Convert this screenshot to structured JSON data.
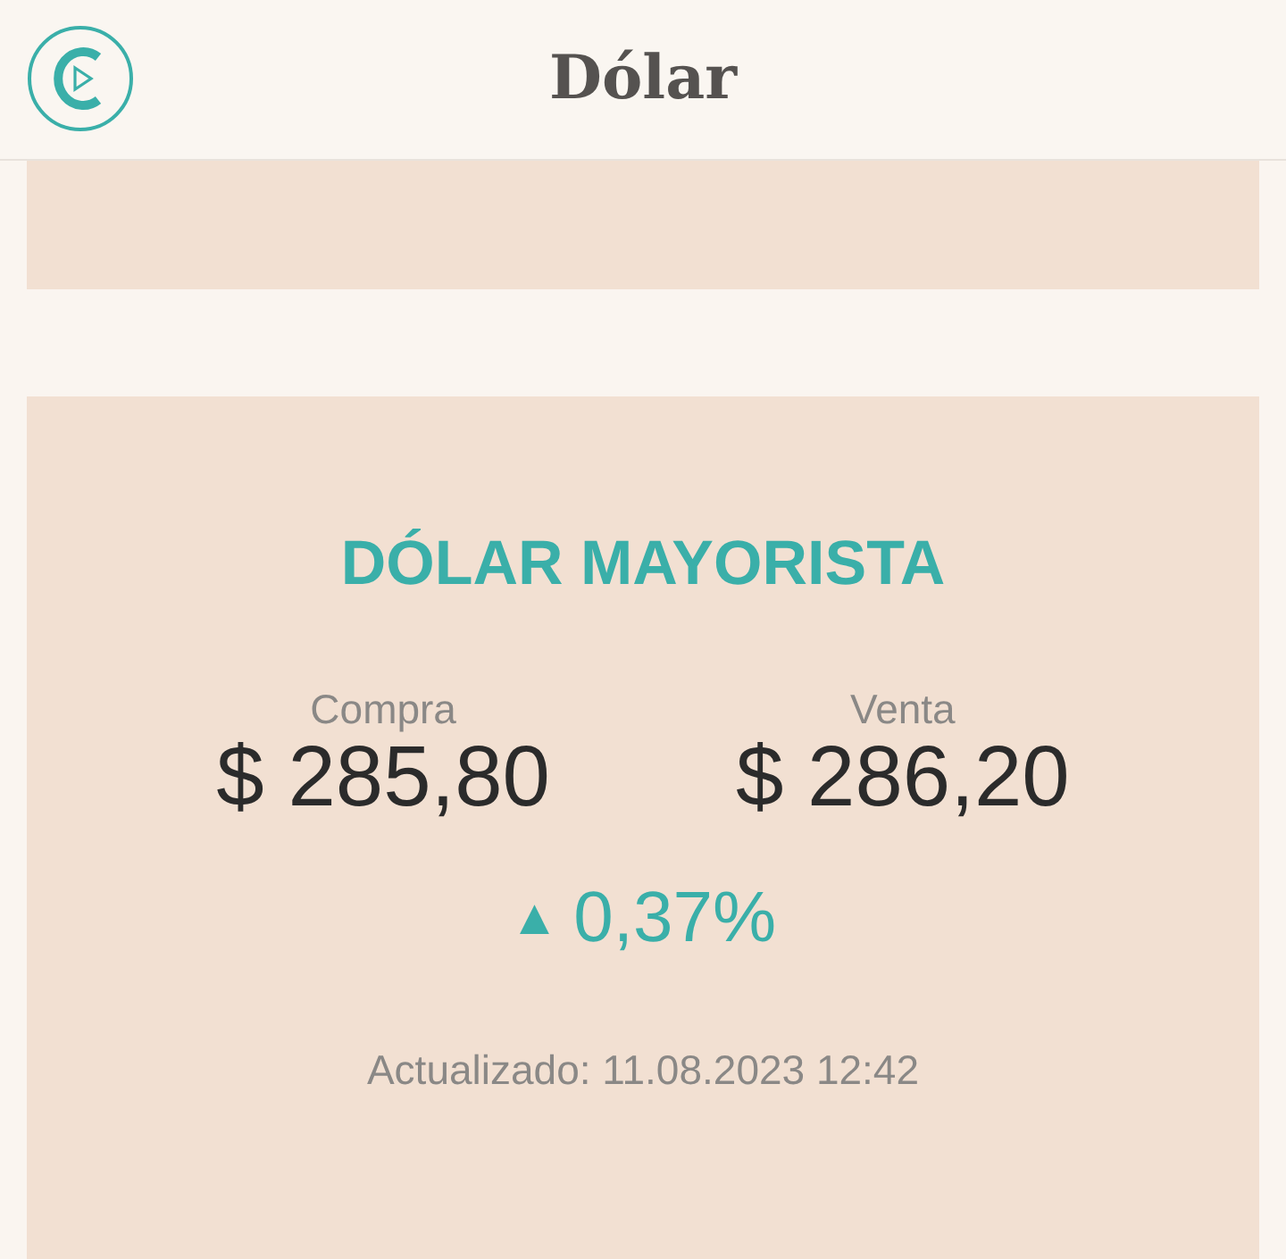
{
  "header": {
    "title": "Dólar"
  },
  "card": {
    "title": "DÓLAR MAYORISTA",
    "quotes": [
      {
        "label": "Compra",
        "value": "$ 285,80"
      },
      {
        "label": "Venta",
        "value": "$ 286,20"
      }
    ],
    "change": {
      "arrow": "▲",
      "value": "0,37%"
    },
    "updated": "Actualizado: 11.08.2023 12:42"
  }
}
